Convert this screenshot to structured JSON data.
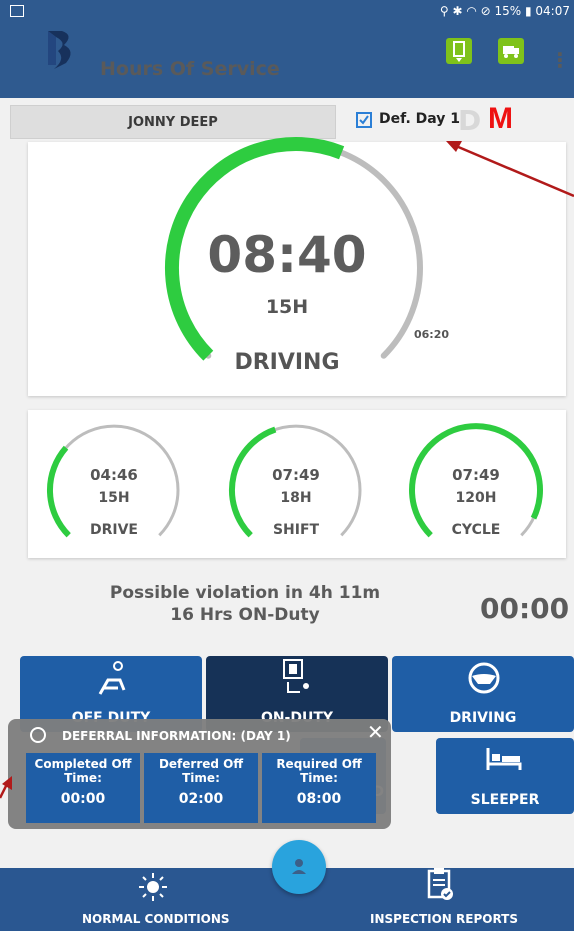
{
  "status_bar": {
    "right_text": "⚲ ✱ ◠ ⊘ 15% ▮ 04:07"
  },
  "app_bar": {
    "title": "Hours Of Service",
    "icons": [
      "tablet-icon",
      "truck-icon",
      "more-vert-icon"
    ]
  },
  "driver": {
    "name": "JONNY DEEP",
    "deferral_checked": true,
    "deferral_label": "Def. Day 1",
    "letter_d": "D",
    "letter_m": "M"
  },
  "main_gauge": {
    "time": "08:40",
    "hours": "15H",
    "label": "DRIVING",
    "remaining": "06:20",
    "fill_fraction": 0.58,
    "color_fill": "#2ecc40",
    "color_track": "#bdbdbd"
  },
  "gauges": [
    {
      "time": "04:46",
      "hours": "15H",
      "label": "DRIVE",
      "fill_fraction": 0.32
    },
    {
      "time": "07:49",
      "hours": "18H",
      "label": "SHIFT",
      "fill_fraction": 0.43
    },
    {
      "time": "07:49",
      "hours": "120H",
      "label": "CYCLE",
      "fill_fraction": 0.93
    }
  ],
  "violation": {
    "line1": "Possible violation in 4h 11m",
    "line2": "16 Hrs ON-Duty",
    "counter": "00:00"
  },
  "status_buttons": {
    "off_duty": "OFF DUTY",
    "on_duty": "ON-DUTY",
    "driving": "DRIVING",
    "sleeper": "SLEEPER",
    "partial_d": "D"
  },
  "deferral_popup": {
    "title": "DEFERRAL INFORMATION: (DAY 1)",
    "close": "✕",
    "cells": [
      {
        "header": "Completed Off Time:",
        "value": "00:00"
      },
      {
        "header": "Deferred Off Time:",
        "value": "02:00"
      },
      {
        "header": "Required Off Time:",
        "value": "08:00"
      }
    ]
  },
  "bottom_nav": {
    "left_label": "NORMAL CONDITIONS",
    "right_label": "INSPECTION REPORTS"
  },
  "colors": {
    "primary": "#2f5a8f",
    "button": "#1f5ea6",
    "button_active": "#163257",
    "accent_green": "#7fc21a",
    "arrow_red": "#b11a1a"
  }
}
